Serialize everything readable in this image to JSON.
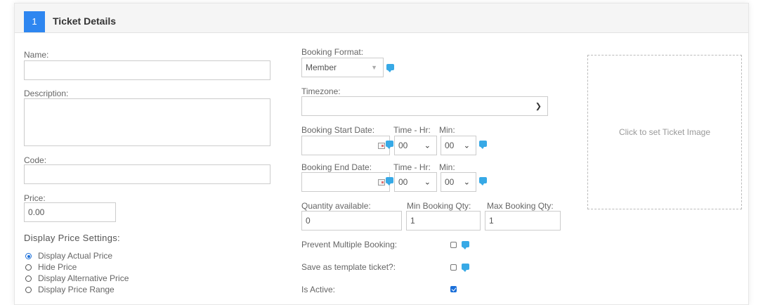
{
  "header": {
    "step": "1",
    "title": "Ticket Details"
  },
  "left": {
    "name_label": "Name:",
    "name_value": "",
    "description_label": "Description:",
    "description_value": "",
    "code_label": "Code:",
    "code_value": "",
    "price_label": "Price:",
    "price_value": "0.00",
    "display_price_title": "Display Price Settings:",
    "price_options": [
      {
        "label": "Display Actual Price",
        "selected": true
      },
      {
        "label": "Hide Price",
        "selected": false
      },
      {
        "label": "Display Alternative Price",
        "selected": false
      },
      {
        "label": "Display Price Range",
        "selected": false
      }
    ]
  },
  "middle": {
    "booking_format_label": "Booking Format:",
    "booking_format_value": "Member",
    "timezone_label": "Timezone:",
    "timezone_value": "",
    "start_date_label": "Booking Start Date:",
    "end_date_label": "Booking End Date:",
    "time_hr_label": "Time - Hr:",
    "min_label": "Min:",
    "start_hr": "00",
    "start_min": "00",
    "end_hr": "00",
    "end_min": "00",
    "qty_label": "Quantity available:",
    "qty_value": "0",
    "min_qty_label": "Min Booking Qty:",
    "min_qty_value": "1",
    "max_qty_label": "Max Booking Qty:",
    "max_qty_value": "1",
    "prevent_label": "Prevent Multiple Booking:",
    "prevent_checked": false,
    "template_label": "Save as template ticket?:",
    "template_checked": false,
    "active_label": "Is Active:",
    "active_checked": true
  },
  "right": {
    "image_placeholder": "Click to set Ticket Image"
  },
  "icons": {
    "help": "chat-bubble-icon",
    "calendar": "calendar-icon",
    "dropdown": "chevron-down-icon"
  },
  "colors": {
    "accent": "#2e86f0",
    "help_icon": "#37a9e6",
    "checkbox_checked": "#1b6fd9"
  }
}
